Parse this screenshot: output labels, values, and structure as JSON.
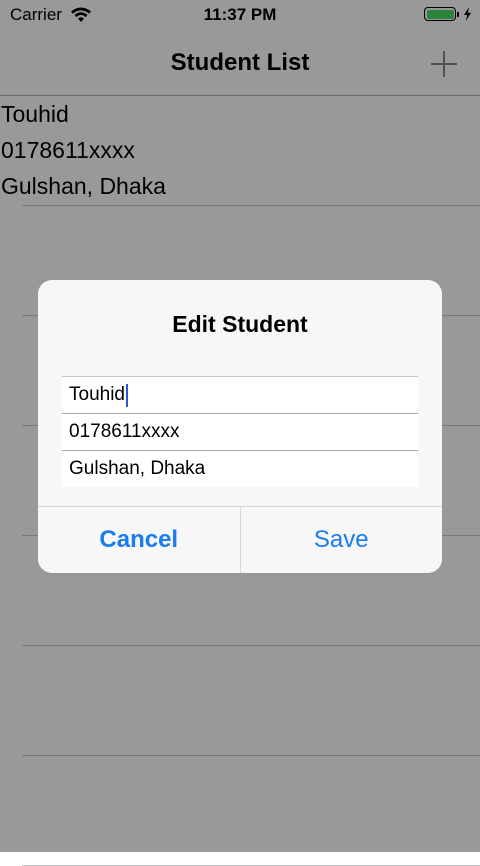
{
  "status_bar": {
    "carrier": "Carrier",
    "time": "11:37 PM",
    "battery_color": "#4cd964"
  },
  "nav": {
    "title": "Student List",
    "add_icon": "plus-icon"
  },
  "list": {
    "items": [
      {
        "name": "Touhid",
        "phone": "0178611xxxx",
        "address": "Gulshan, Dhaka"
      }
    ]
  },
  "alert": {
    "title": "Edit Student",
    "fields": {
      "name": "Touhid",
      "phone": "0178611xxxx",
      "address": "Gulshan, Dhaka"
    },
    "cancel_label": "Cancel",
    "save_label": "Save",
    "accent_color": "#1a7cf1"
  }
}
